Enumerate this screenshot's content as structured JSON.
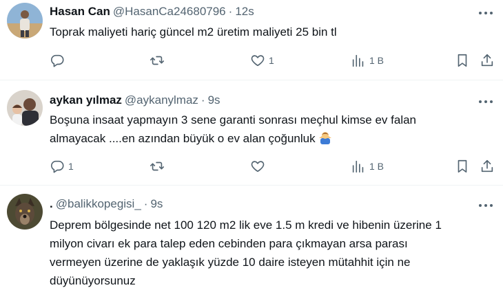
{
  "tweets": [
    {
      "name": "Hasan Can",
      "handle": "@HasanCa24680796",
      "separator": "·",
      "time": "12s",
      "lines": [
        "Toprak maliyeti hariç güncel m2 üretim maliyeti 25 bin tl"
      ],
      "stats": {
        "reply": "",
        "retweet": "",
        "like": "1",
        "views": "1 B"
      }
    },
    {
      "name": "aykan yılmaz",
      "handle": "@aykanylmaz",
      "separator": "·",
      "time": "9s",
      "lines": [
        "Boşuna insaat yapmayın 3 sene garanti sonrası meçhul kimse ev falan",
        "almayacak ....en azından büyük o ev alan çoğunluk"
      ],
      "stats": {
        "reply": "1",
        "retweet": "",
        "like": "",
        "views": "1 B"
      }
    },
    {
      "name": ".",
      "handle": "@balikkopegisi_",
      "separator": "·",
      "time": "9s",
      "lines": [
        "Deprem bölgesinde net  100 120 m2 lik eve 1.5 m kredi ve hibenin üzerine 1",
        "milyon civarı ek para talep eden  cebinden para çıkmayan arsa parası",
        "vermeyen üzerine de yaklaşık yüzde 10 daire isteyen mütahhit için ne",
        "düyünüyorsunuz"
      ]
    }
  ],
  "icons": {
    "more": "more-horizontal-icon",
    "reply": "reply-icon",
    "retweet": "retweet-icon",
    "like": "heart-icon",
    "views": "analytics-icon",
    "bookmark": "bookmark-icon",
    "share": "share-icon",
    "emoji": "person-shrugging-emoji"
  },
  "colors": {
    "text": "#0f1419",
    "secondary": "#536471",
    "divider": "#eff3f4"
  }
}
